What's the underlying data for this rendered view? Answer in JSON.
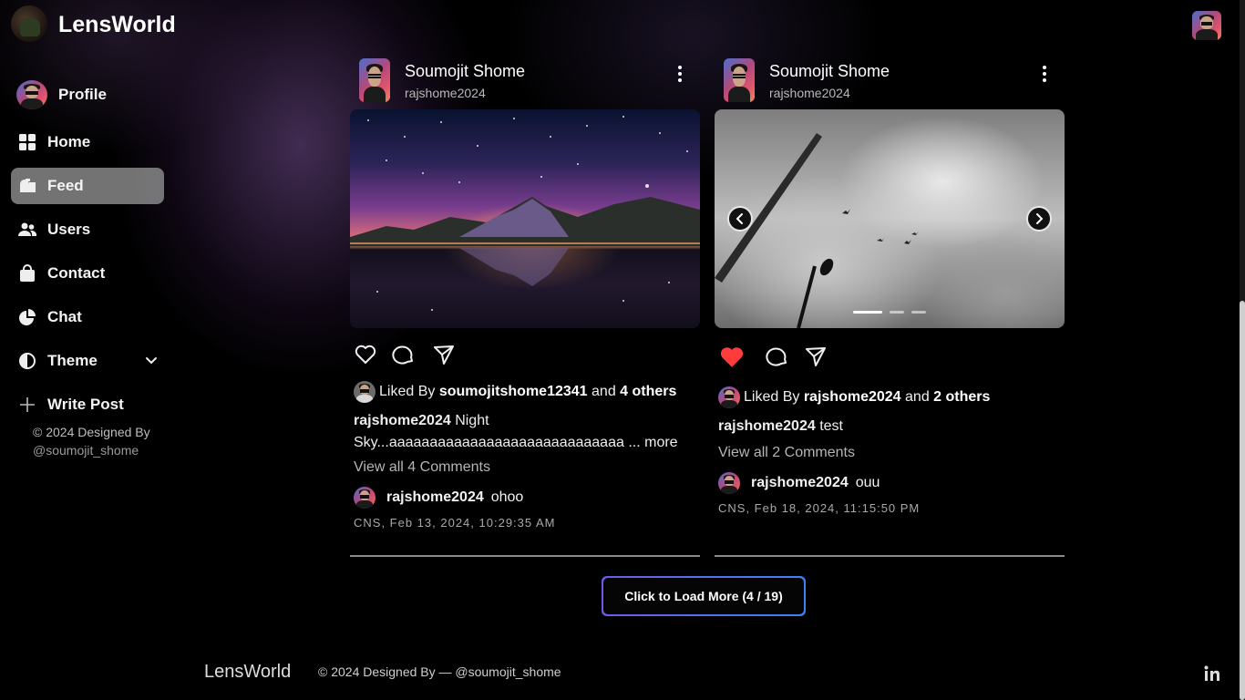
{
  "app": {
    "brand": "LensWorld"
  },
  "sidebar": {
    "items": [
      {
        "label": "Profile",
        "icon": "profile-avatar"
      },
      {
        "label": "Home",
        "icon": "grid-icon"
      },
      {
        "label": "Feed",
        "icon": "mailbox-icon",
        "active": true
      },
      {
        "label": "Users",
        "icon": "users-icon"
      },
      {
        "label": "Contact",
        "icon": "bag-icon"
      },
      {
        "label": "Chat",
        "icon": "pie-icon"
      },
      {
        "label": "Theme",
        "icon": "contrast-icon",
        "has_dropdown": true
      },
      {
        "label": "Write Post",
        "icon": "plus-icon"
      }
    ],
    "footer_text": "© 2024 Designed By",
    "footer_handle": "@soumojit_shome"
  },
  "posts": [
    {
      "author_name": "Soumojit Shome",
      "author_handle": "rajshome2024",
      "liked_prefix": "Liked By",
      "liked_user": "soumojitshome12341",
      "liked_and": "and",
      "liked_others": "4 others",
      "liked": false,
      "caption_user": "rajshome2024",
      "caption_text": "Night Sky...aaaaaaaaaaaaaaaaaaaaaaaaaaaaa",
      "caption_more": "... more",
      "view_comments": "View all 4 Comments",
      "comment_user": "rajshome2024",
      "comment_text": "ohoo",
      "timestamp": "CNS, Feb 13, 2024, 10:29:35 AM",
      "image": "night-sky-mountain-lake"
    },
    {
      "author_name": "Soumojit Shome",
      "author_handle": "rajshome2024",
      "liked_prefix": "Liked By",
      "liked_user": "rajshome2024",
      "liked_and": "and",
      "liked_others": "2 others",
      "liked": true,
      "caption_user": "rajshome2024",
      "caption_text": "test",
      "view_comments": "View all 2 Comments",
      "comment_user": "rajshome2024",
      "comment_text": "ouu",
      "timestamp": "CNS, Feb 18, 2024, 11:15:50 PM",
      "image": "cloudy-sky-with-birds",
      "carousel": {
        "slides": 3,
        "current": 1
      }
    }
  ],
  "load_more": {
    "label": "Click to Load More (4 / 19)"
  },
  "footer": {
    "brand": "LensWorld",
    "copy": "© 2024 Designed By — @soumojit_shome",
    "social_icon": "linkedin-icon"
  },
  "colors": {
    "like_active": "#ff3b3b",
    "active_nav": "#a0a0a0",
    "load_more_border_start": "#6c5ce7",
    "load_more_border_end": "#3b82f6"
  }
}
